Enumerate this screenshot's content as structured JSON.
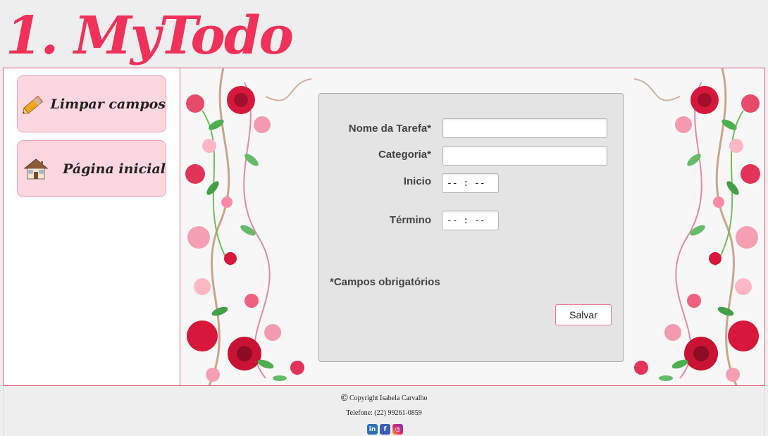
{
  "app": {
    "title": "1. MyTodo"
  },
  "sidebar": {
    "items": [
      {
        "label": "Limpar campos",
        "icon": "pencil-icon"
      },
      {
        "label": "Página inicial",
        "icon": "house-icon"
      }
    ]
  },
  "form": {
    "task_name_label": "Nome da Tarefa*",
    "task_name_value": "",
    "category_label": "Categoria*",
    "category_value": "",
    "start_label": "Inicio",
    "start_value": "-- : --",
    "end_label": "Término",
    "end_value": "-- : --",
    "required_note": "*Campos obrigatórios",
    "save_label": "Salvar"
  },
  "footer": {
    "copyright_symbol": "©",
    "copyright_text": "Copyright Isabela Carvalho",
    "phone": "Telefone: (22) 99261-0859",
    "social": [
      {
        "icon": "linkedin-icon",
        "glyph": "in",
        "color": "#2b72b8"
      },
      {
        "icon": "facebook-icon",
        "glyph": "f",
        "color": "#3b5bb5"
      },
      {
        "icon": "instagram-icon",
        "glyph": "◎",
        "color": "#c23a9a"
      }
    ]
  },
  "colors": {
    "accent": "#f0325a",
    "button_bg": "#fdd7df",
    "frame_border": "#e0607a"
  }
}
